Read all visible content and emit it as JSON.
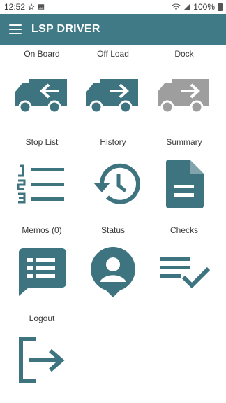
{
  "status_bar": {
    "time": "12:52",
    "battery": "100%"
  },
  "app_bar": {
    "title": "LSP DRIVER"
  },
  "colors": {
    "primary": "#3f7a86",
    "icon": "#3e7380",
    "disabled": "#9e9e9e"
  },
  "menu": {
    "on_board": "On Board",
    "off_load": "Off Load",
    "dock": "Dock",
    "stop_list": "Stop List",
    "history": "History",
    "summary": "Summary",
    "memos": "Memos (0)",
    "status": "Status",
    "checks": "Checks",
    "logout": "Logout"
  }
}
